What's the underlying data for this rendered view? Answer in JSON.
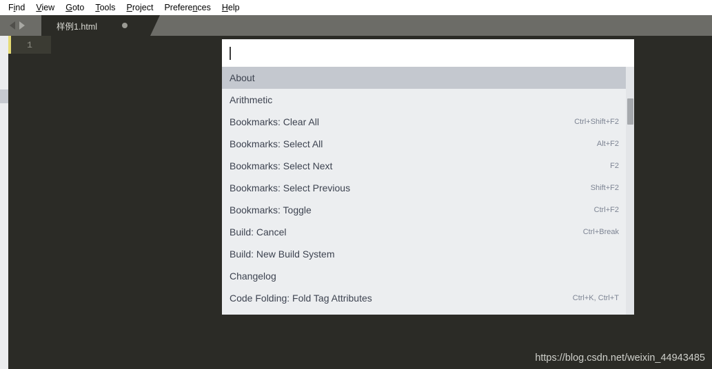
{
  "menubar": {
    "items": [
      {
        "pre": "F",
        "acc": "i",
        "post": "nd"
      },
      {
        "pre": "",
        "acc": "V",
        "post": "iew"
      },
      {
        "pre": "",
        "acc": "G",
        "post": "oto"
      },
      {
        "pre": "",
        "acc": "T",
        "post": "ools"
      },
      {
        "pre": "",
        "acc": "P",
        "post": "roject"
      },
      {
        "pre": "Prefere",
        "acc": "n",
        "post": "ces"
      },
      {
        "pre": "",
        "acc": "H",
        "post": "elp"
      }
    ]
  },
  "tabbar": {
    "nav_back_icon": "triangle-left-icon",
    "nav_forward_icon": "triangle-right-icon",
    "tab": {
      "title": "样例1.html",
      "dirty_indicator": "unsaved-dot"
    }
  },
  "editor": {
    "line_number": "1",
    "caret_color": "#e6db74"
  },
  "palette": {
    "input_value": "",
    "rows": [
      {
        "label": "About",
        "shortcut": "",
        "selected": true
      },
      {
        "label": "Arithmetic",
        "shortcut": "",
        "selected": false
      },
      {
        "label": "Bookmarks: Clear All",
        "shortcut": "Ctrl+Shift+F2",
        "selected": false
      },
      {
        "label": "Bookmarks: Select All",
        "shortcut": "Alt+F2",
        "selected": false
      },
      {
        "label": "Bookmarks: Select Next",
        "shortcut": "F2",
        "selected": false
      },
      {
        "label": "Bookmarks: Select Previous",
        "shortcut": "Shift+F2",
        "selected": false
      },
      {
        "label": "Bookmarks: Toggle",
        "shortcut": "Ctrl+F2",
        "selected": false
      },
      {
        "label": "Build: Cancel",
        "shortcut": "Ctrl+Break",
        "selected": false
      },
      {
        "label": "Build: New Build System",
        "shortcut": "",
        "selected": false
      },
      {
        "label": "Changelog",
        "shortcut": "",
        "selected": false
      },
      {
        "label": "Code Folding: Fold Tag Attributes",
        "shortcut": "Ctrl+K, Ctrl+T",
        "selected": false
      }
    ]
  },
  "watermark": {
    "text": "https://blog.csdn.net/weixin_44943485"
  },
  "colors": {
    "editor_bg": "#2b2b26",
    "tabbar_bg": "#6c6c67",
    "palette_bg": "#eceef0",
    "palette_selected": "#c4c8cf",
    "menubar_bg": "#ffffff"
  }
}
